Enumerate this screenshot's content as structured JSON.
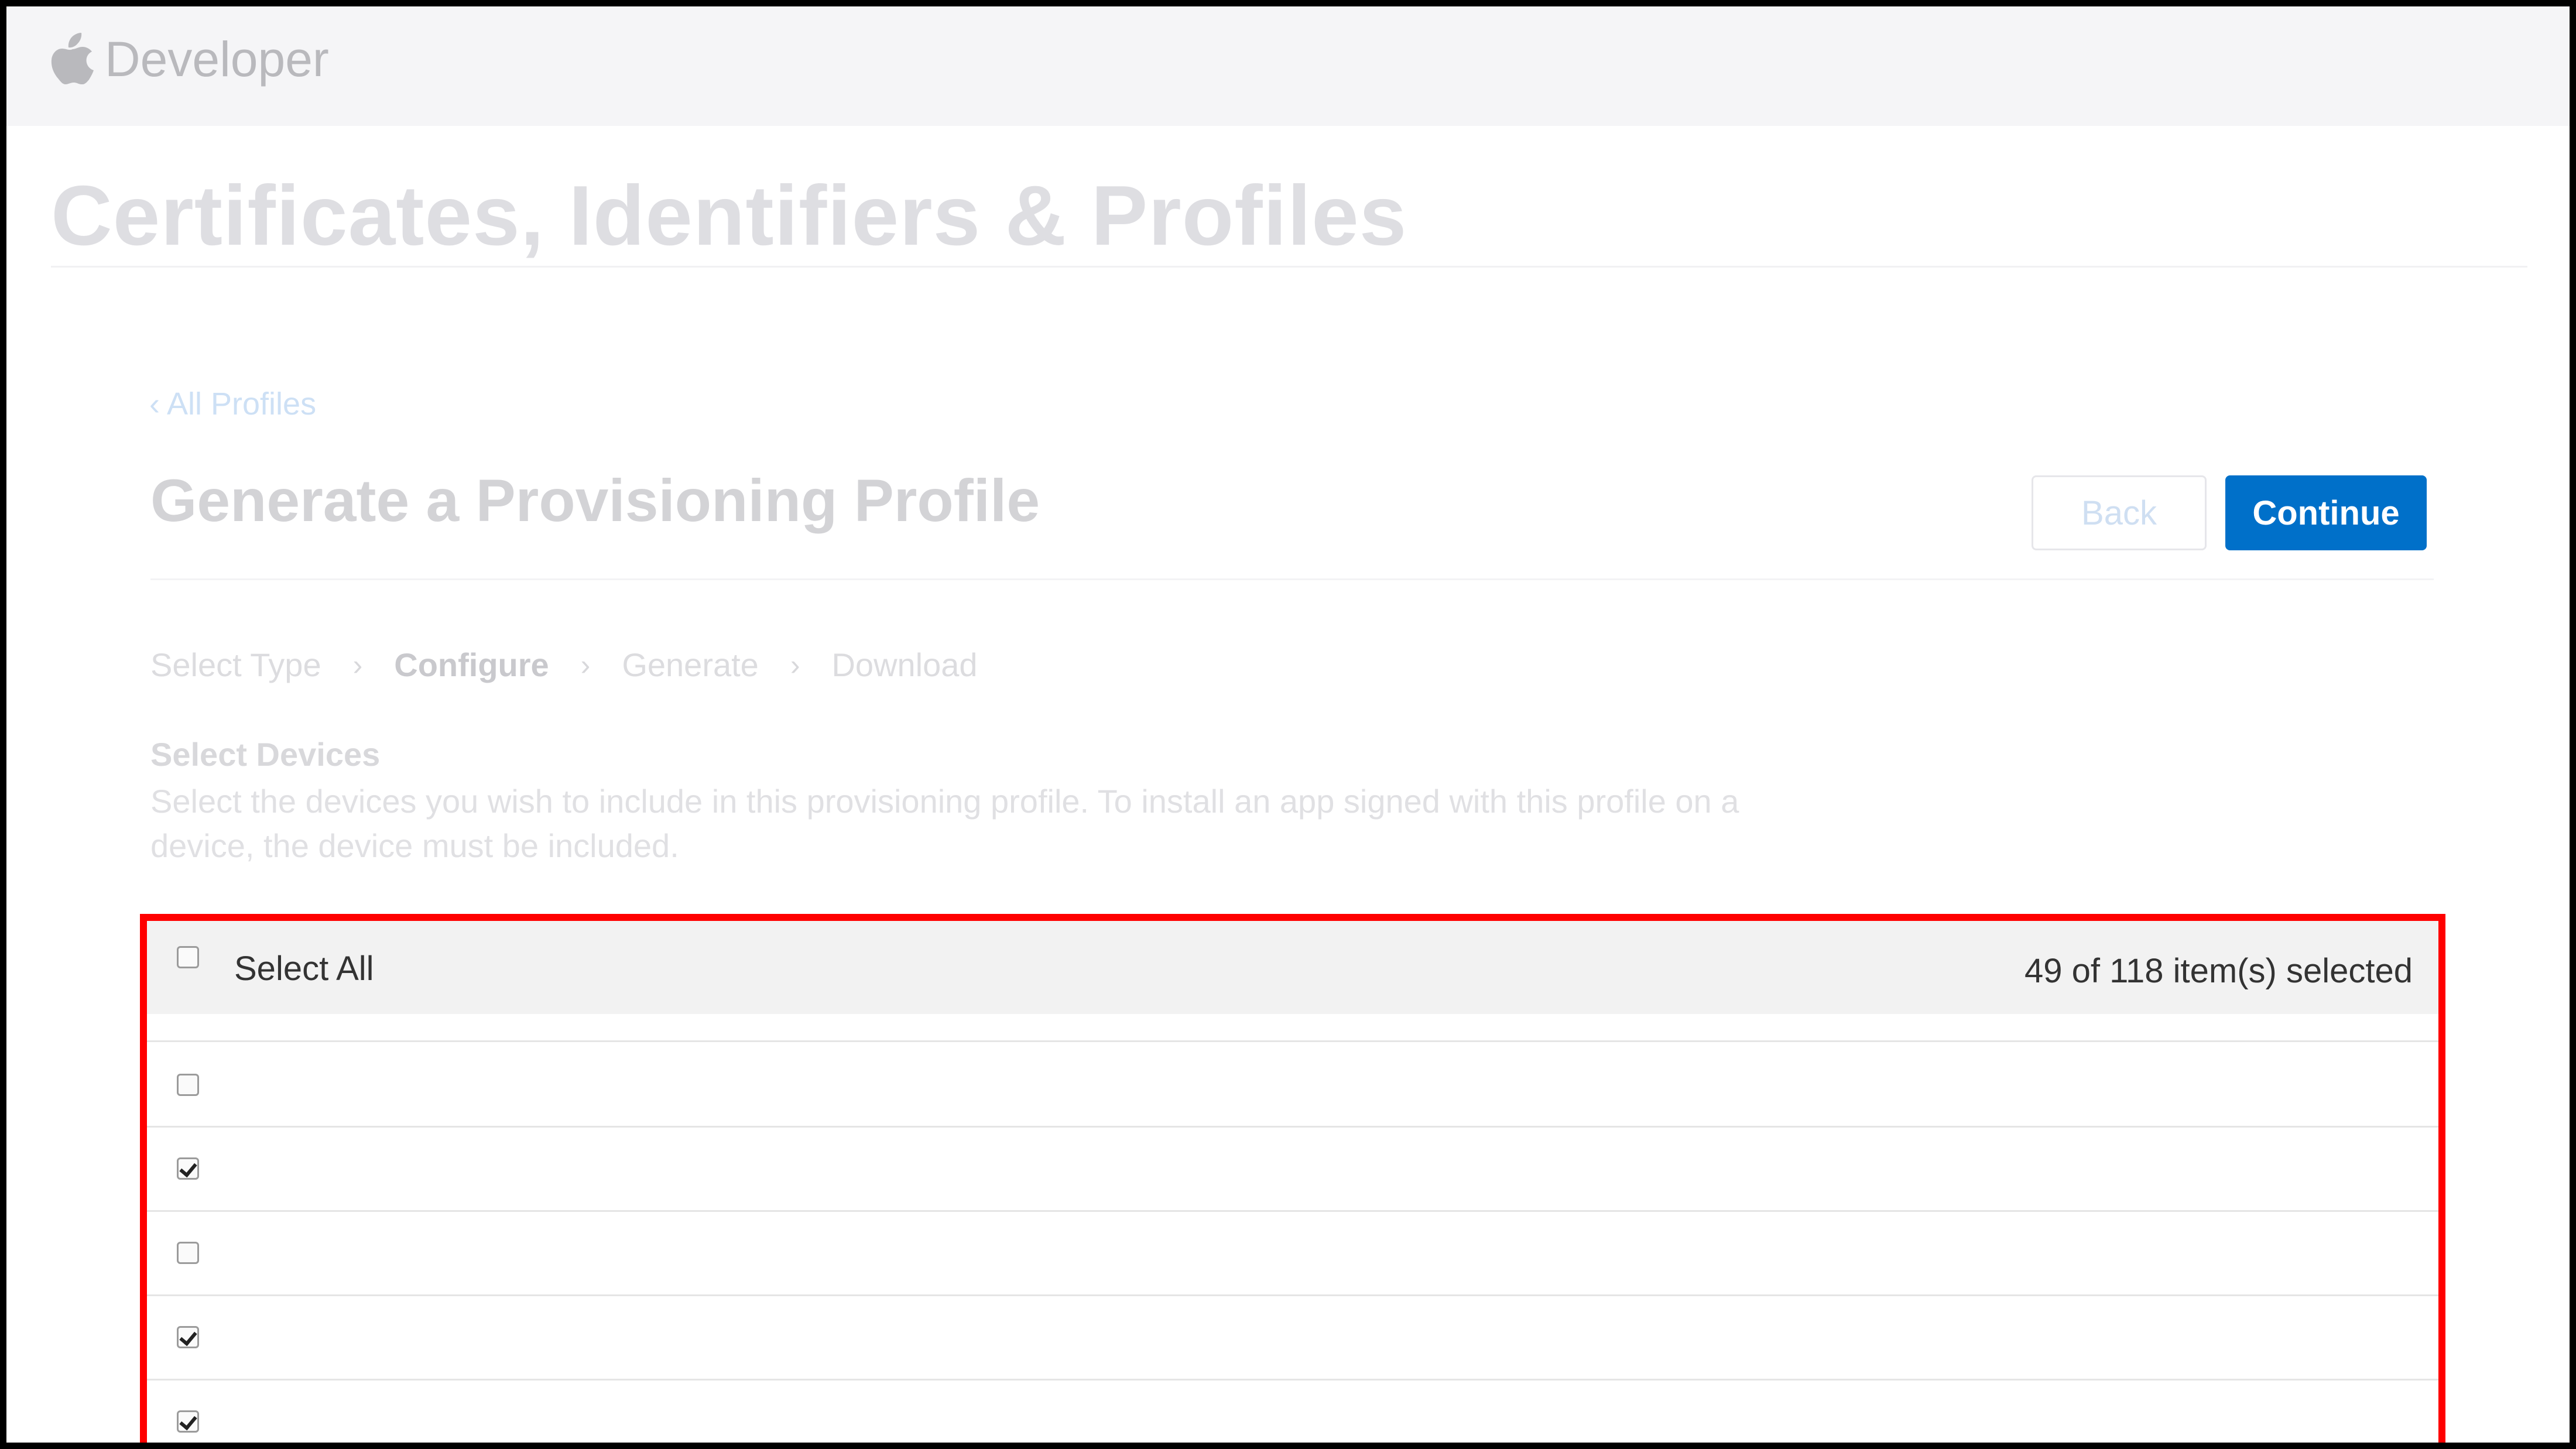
{
  "nav": {
    "brand": "Developer",
    "logo_icon": "apple-logo-icon"
  },
  "section_title": "Certificates, Identifiers & Profiles",
  "breadcrumb": "‹ All Profiles",
  "page_heading": "Generate a Provisioning Profile",
  "buttons": {
    "back": "Back",
    "continue": "Continue"
  },
  "steps": [
    {
      "label": "Select Type",
      "active": false
    },
    {
      "label": "Configure",
      "active": true
    },
    {
      "label": "Generate",
      "active": false
    },
    {
      "label": "Download",
      "active": false
    }
  ],
  "devices": {
    "title": "Select Devices",
    "description": "Select the devices you wish to include in this provisioning profile. To install an app signed with this profile on a device, the device must be included.",
    "select_all_label": "Select All",
    "selected_count": "49 of 118 item(s) selected",
    "select_all_checked": false,
    "rows": [
      {
        "checked": false
      },
      {
        "checked": true
      },
      {
        "checked": false
      },
      {
        "checked": true
      },
      {
        "checked": true
      }
    ]
  },
  "colors": {
    "accent": "#0070c9",
    "highlight_border": "#ff0000"
  }
}
